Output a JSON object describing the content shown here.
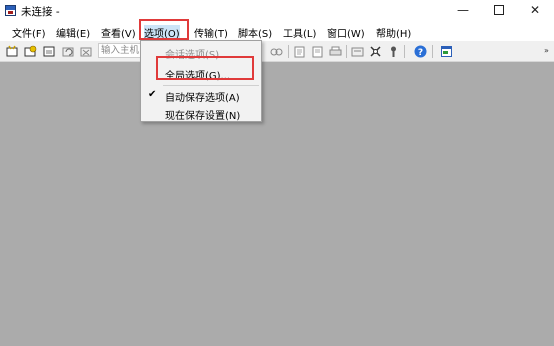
{
  "window": {
    "title": "未连接 -",
    "min_glyph": "—",
    "close_glyph": "✕"
  },
  "menubar": {
    "items": [
      {
        "label": "文件(F)"
      },
      {
        "label": "编辑(E)"
      },
      {
        "label": "查看(V)"
      },
      {
        "label": "选项(O)"
      },
      {
        "label": "传输(T)"
      },
      {
        "label": "脚本(S)"
      },
      {
        "label": "工具(L)"
      },
      {
        "label": "窗口(W)"
      },
      {
        "label": "帮助(H)"
      }
    ]
  },
  "toolbar": {
    "host_placeholder": "输入主机"
  },
  "options_menu": {
    "items": [
      {
        "label": "会话选项(S)...",
        "enabled": false
      },
      {
        "label": "全局选项(G)...",
        "enabled": true
      },
      {
        "label": "自动保存选项(A)",
        "enabled": true,
        "checked": true,
        "check_glyph": "✔"
      },
      {
        "label": "现在保存设置(N)",
        "enabled": true
      }
    ]
  },
  "colors": {
    "highlight": "#e03a3a",
    "workspace": "#ababab",
    "active_menu": "#cce4f7"
  }
}
